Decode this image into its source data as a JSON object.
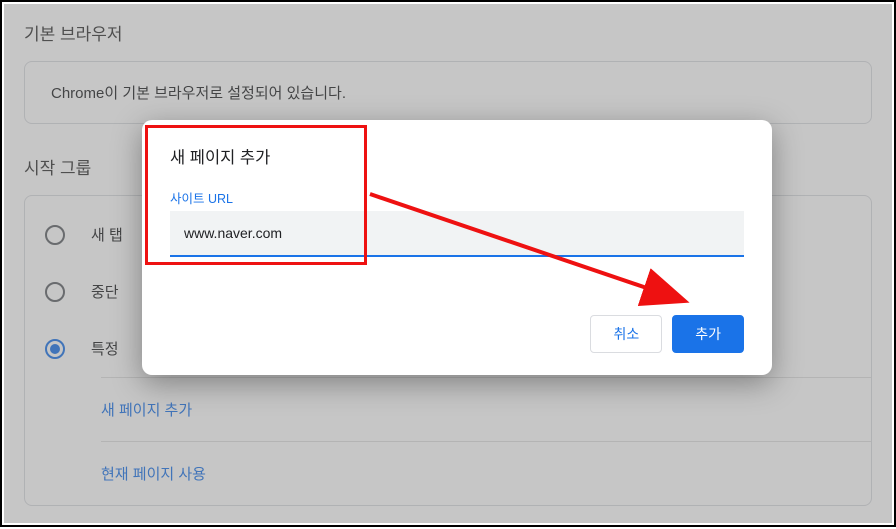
{
  "sections": {
    "defaultBrowser": {
      "title": "기본 브라우저",
      "message": "Chrome이 기본 브라우저로 설정되어 있습니다."
    },
    "onStart": {
      "title": "시작 그룹",
      "options": {
        "newTab": "새 탭",
        "continue": "중단",
        "specific": "특정"
      },
      "links": {
        "addPage": "새 페이지 추가",
        "useCurrent": "현재 페이지 사용"
      }
    }
  },
  "dialog": {
    "title": "새 페이지 추가",
    "fieldLabel": "사이트 URL",
    "urlValue": "www.naver.com",
    "cancel": "취소",
    "add": "추가"
  }
}
